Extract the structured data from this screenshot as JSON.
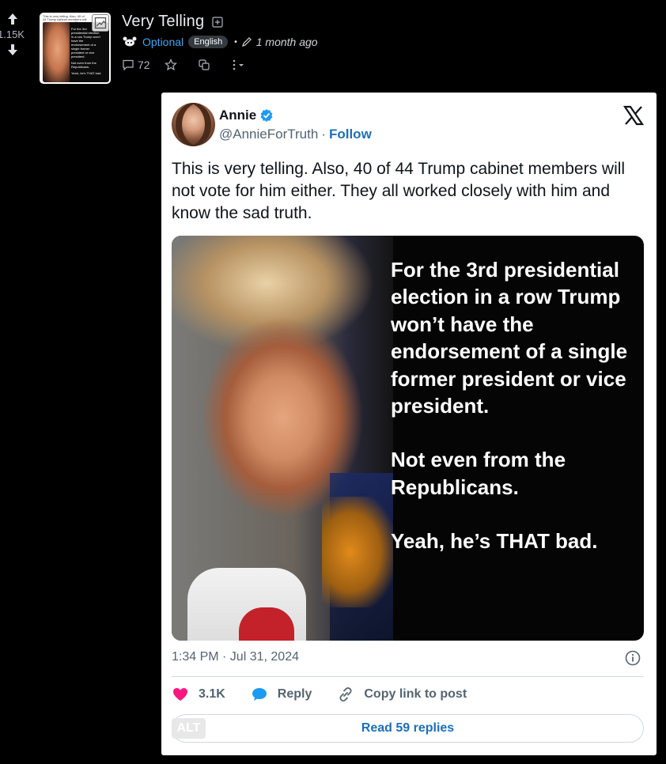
{
  "post": {
    "score": "1.15K",
    "title": "Very Telling",
    "community": "Optional",
    "language": "English",
    "time_ago": "1 month ago",
    "comment_count": "72"
  },
  "thumbnail": {
    "tweet_line": "This is very telling. Also, 40 of 44 Trump cabinet members will not vote for him either. They all worked closely with him and know the sad truth.",
    "overlay_lines": [
      "For the 3rd",
      "presidential election",
      "in a row Trump won't",
      "have the",
      "endorsement of a",
      "single former",
      "president or vice",
      "president.",
      "Not even from the",
      "Republicans.",
      "Yeah, he's THAT bad."
    ]
  },
  "tweet": {
    "name": "Annie",
    "handle": "@AnnieForTruth",
    "separator": "·",
    "follow_label": "Follow",
    "text": "This is very telling. Also, 40 of 44 Trump cabinet members will not vote for him either. They all worked closely with him and know the sad truth.",
    "image_text": {
      "p1": "For the 3rd presidential election in a row Trump won’t have the endorsement of a single former president or vice president.",
      "p2": "Not even from the Republicans.",
      "p3": "Yeah, he’s THAT bad."
    },
    "timestamp": "1:34 PM · Jul 31, 2024",
    "likes": "3.1K",
    "reply_label": "Reply",
    "copy_link_label": "Copy link to post",
    "read_replies_label": "Read 59 replies",
    "alt_badge": "ALT"
  },
  "colors": {
    "background": "#000000",
    "link_blue": "#3fa4f5",
    "follow_blue": "#1d6fb8",
    "like_pink": "#f91880",
    "reply_blue": "#1d9bf0"
  }
}
